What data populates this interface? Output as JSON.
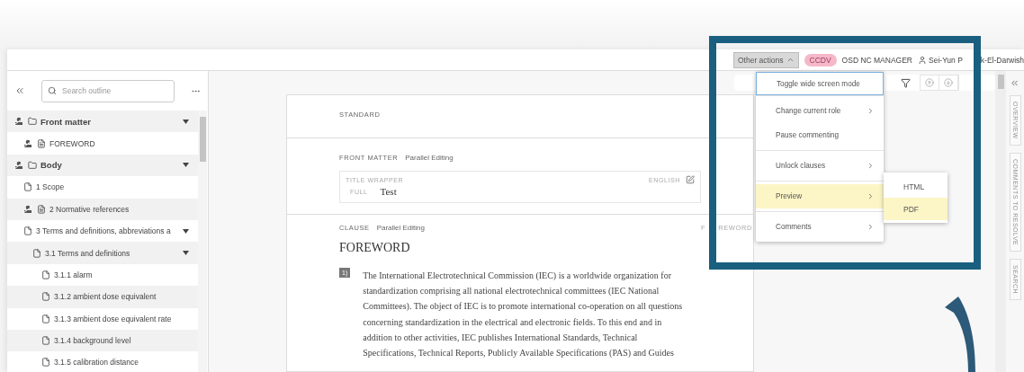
{
  "header": {
    "actions_button": {
      "label": "Other actions",
      "expanded": true
    },
    "badge": "CCDV",
    "role": "OSD NC MANAGER",
    "user_visible_parts": [
      "Sei-Yun P",
      "k-El-Darwish"
    ]
  },
  "actions_menu": {
    "groups": [
      [
        {
          "label": "Toggle wide screen mode",
          "has_submenu": false,
          "selected": false,
          "focused": true
        }
      ],
      [
        {
          "label": "Change current role",
          "has_submenu": true,
          "selected": false,
          "focused": false
        },
        {
          "label": "Pause commenting",
          "has_submenu": false,
          "selected": false,
          "focused": false
        }
      ],
      [
        {
          "label": "Unlock clauses",
          "has_submenu": true,
          "selected": false,
          "focused": false
        }
      ],
      [
        {
          "label": "Preview",
          "has_submenu": true,
          "selected": true,
          "focused": false
        }
      ],
      [
        {
          "label": "Comments",
          "has_submenu": true,
          "selected": false,
          "focused": false
        }
      ]
    ],
    "submenu": [
      {
        "label": "HTML",
        "selected": false
      },
      {
        "label": "PDF",
        "selected": true
      }
    ]
  },
  "outline": {
    "search": {
      "placeholder": "Search outline"
    },
    "tree": [
      {
        "label": "Front matter",
        "kind": "folder",
        "locked": true,
        "expanded": true,
        "children": [
          {
            "label": "FOREWORD",
            "kind": "document",
            "locked": true
          }
        ]
      },
      {
        "label": "Body",
        "kind": "folder",
        "locked": true,
        "expanded": true,
        "children": [
          {
            "label": "1 Scope",
            "kind": "page",
            "locked": false
          },
          {
            "label": "2 Normative references",
            "kind": "document",
            "locked": true
          },
          {
            "label": "3 Terms and definitions, abbreviations a",
            "kind": "page",
            "locked": false,
            "expanded": true,
            "children": [
              {
                "label": "3.1 Terms and definitions",
                "kind": "page",
                "locked": false,
                "expanded": true,
                "children": [
                  {
                    "label": "3.1.1 alarm",
                    "kind": "page",
                    "locked": false
                  },
                  {
                    "label": "3.1.2 ambient dose equivalent",
                    "kind": "page",
                    "locked": false
                  },
                  {
                    "label": "3.1.3 ambient dose equivalent rate",
                    "kind": "page",
                    "locked": false
                  },
                  {
                    "label": "3.1.4 background level",
                    "kind": "page",
                    "locked": false
                  },
                  {
                    "label": "3.1.5 calibration distance",
                    "kind": "page",
                    "locked": false
                  }
                ]
              }
            ]
          }
        ]
      }
    ]
  },
  "document": {
    "standard_label": "STANDARD",
    "front_matter": {
      "label": "FRONT MATTER",
      "mode": "Parallel Editing",
      "title_wrapper": {
        "label": "TITLE WRAPPER",
        "language": "ENGLISH",
        "field": "FULL",
        "value": "Test"
      }
    },
    "clause": {
      "label": "CLAUSE",
      "mode": "Parallel Editing",
      "tag_visible_parts": [
        "F",
        "REWORD"
      ],
      "title": "FOREWORD",
      "paragraph_number": "1)",
      "paragraph": "The International Electrotechnical Commission (IEC) is a worldwide organization for standardization comprising all national electrotechnical committees (IEC National Committees). The object of IEC is to promote international co-operation on all questions concerning standardization in the electrical and electronic fields. To this end and in addition to other activities, IEC publishes International Standards, Technical Specifications, Technical Reports, Publicly Available Specifications (PAS) and Guides"
    }
  },
  "side_tabs": [
    "OVERVIEW",
    "COMMENTS TO RESOLVE",
    "SEARCH"
  ]
}
